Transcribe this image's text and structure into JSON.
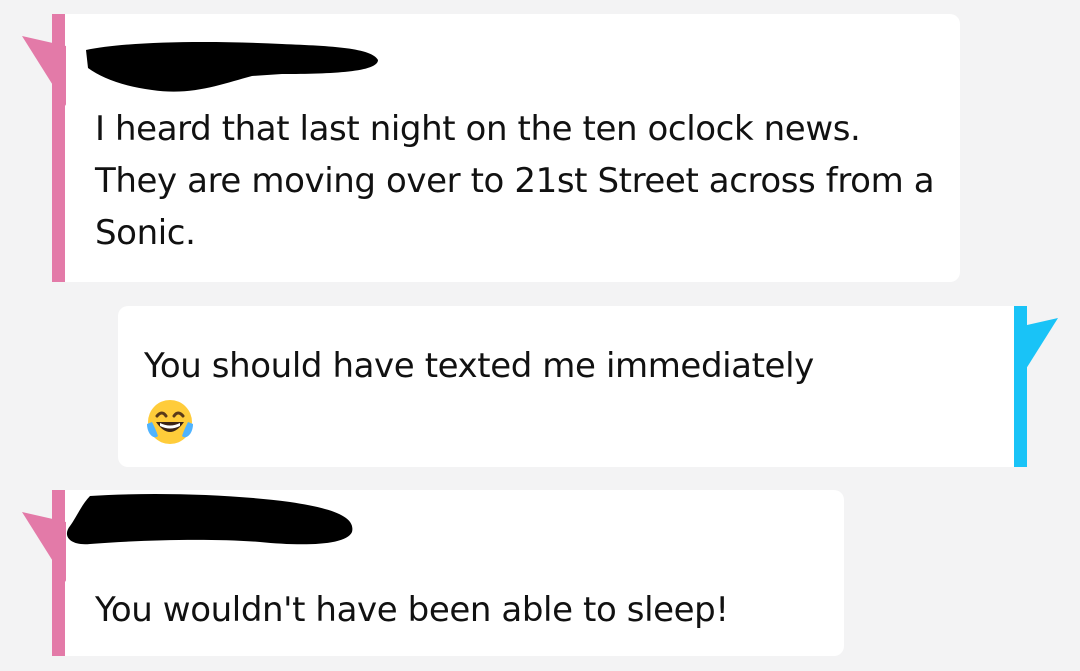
{
  "conversation": {
    "messages": [
      {
        "direction": "incoming",
        "sender_redacted": true,
        "text": "I heard that last night on the ten oclock news.  They are moving over to 21st Street across from a Sonic."
      },
      {
        "direction": "outgoing",
        "text": "You should have texted me immediately",
        "emoji": "face-with-tears-of-joy"
      },
      {
        "direction": "incoming",
        "sender_redacted": true,
        "text": "You wouldn't have been able to sleep!"
      }
    ]
  },
  "colors": {
    "background": "#f3f3f4",
    "bubble": "#ffffff",
    "incoming_accent": "#e37aa8",
    "outgoing_accent": "#19c3f7",
    "redaction": "#000000"
  }
}
